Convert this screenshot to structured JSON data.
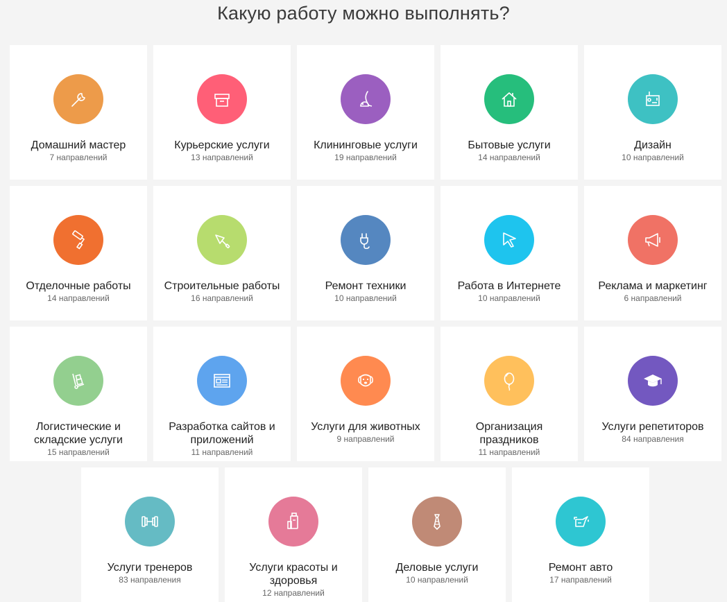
{
  "page": {
    "title": "Какую работу можно выполнять?"
  },
  "categories": [
    {
      "name": "Домашний мастер",
      "count": "7 направлений",
      "color": "#ed9b4a",
      "icon": "wrench-icon"
    },
    {
      "name": "Курьерские услуги",
      "count": "13 направлений",
      "color": "#ff5f77",
      "icon": "box-icon"
    },
    {
      "name": "Клининговые услуги",
      "count": "19 направлений",
      "color": "#9b5fc0",
      "icon": "vacuum-icon"
    },
    {
      "name": "Бытовые услуги",
      "count": "14 направлений",
      "color": "#26be7c",
      "icon": "house-icon"
    },
    {
      "name": "Дизайн",
      "count": "10 направлений",
      "color": "#3ec1c3",
      "icon": "design-tablet-icon"
    },
    {
      "name": "Отделочные работы",
      "count": "14 направлений",
      "color": "#f07030",
      "icon": "paint-roller-icon"
    },
    {
      "name": "Строительные работы",
      "count": "16 направлений",
      "color": "#b7dc6e",
      "icon": "trowel-icon"
    },
    {
      "name": "Ремонт техники",
      "count": "10 направлений",
      "color": "#5587c0",
      "icon": "plug-icon"
    },
    {
      "name": "Работа в Интернете",
      "count": "10 направлений",
      "color": "#1ec4ee",
      "icon": "cursor-icon"
    },
    {
      "name": "Реклама и маркетинг",
      "count": "6 направлений",
      "color": "#f07265",
      "icon": "megaphone-icon"
    },
    {
      "name": "Логистические и складские услуги",
      "count": "15 направлений",
      "color": "#93cf8f",
      "icon": "hand-truck-icon"
    },
    {
      "name": "Разработка сайтов и приложений",
      "count": "11 направлений",
      "color": "#5ea4ee",
      "icon": "browser-window-icon"
    },
    {
      "name": "Услуги для животных",
      "count": "9 направлений",
      "color": "#ff8a50",
      "icon": "dog-icon"
    },
    {
      "name": "Организация праздников",
      "count": "11 направлений",
      "color": "#ffc05c",
      "icon": "balloon-icon"
    },
    {
      "name": "Услуги репетиторов",
      "count": "84 направления",
      "color": "#7358c0",
      "icon": "graduation-cap-icon"
    },
    {
      "name": "Услуги тренеров",
      "count": "83 направления",
      "color": "#65bbc4",
      "icon": "dumbbell-icon"
    },
    {
      "name": "Услуги красоты и здоровья",
      "count": "12 направлений",
      "color": "#e57a98",
      "icon": "cosmetics-bottle-icon"
    },
    {
      "name": "Деловые услуги",
      "count": "10 направлений",
      "color": "#c08a76",
      "icon": "tie-icon"
    },
    {
      "name": "Ремонт авто",
      "count": "17 направлений",
      "color": "#2ec6d2",
      "icon": "oil-can-icon"
    }
  ]
}
